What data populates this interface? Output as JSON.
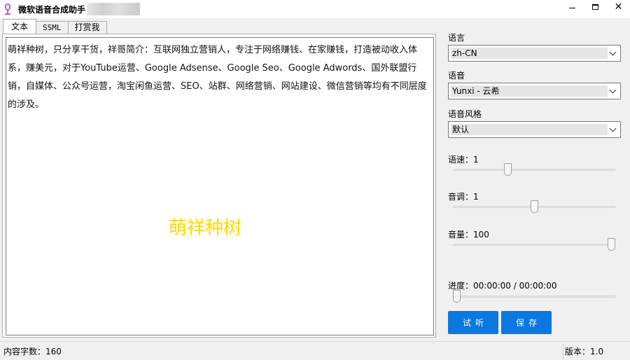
{
  "window": {
    "title": "微软语音合成助手",
    "controls": {
      "minimize": "minimize-icon",
      "maximize": "maximize-icon",
      "close": "✕"
    }
  },
  "tabs": [
    {
      "label": "文本",
      "active": true
    },
    {
      "label": "SSML",
      "active": false
    },
    {
      "label": "打赏我",
      "active": false
    }
  ],
  "editor": {
    "content": "萌祥种树，只分享干货，祥哥简介：互联网独立营销人，专注于网络赚钱、在家赚钱，打造被动收入体系，赚美元，对于YouTube运营、Google Adsense、Google Seo、Google Adwords、国外联盟行销，自媒体、公众号运营，淘宝闲鱼运营、SEO、站群、网络营销、网站建设、微信营销等均有不同层度的涉及。",
    "watermark": "萌祥种树"
  },
  "settings": {
    "language_label": "语言",
    "language_value": "zh-CN",
    "voice_label": "语音",
    "voice_value": "Yunxi - 云希",
    "style_label": "语音风格",
    "style_value": "默认",
    "rate_label": "语速：1",
    "rate_fraction": 0.33,
    "pitch_label": "音调：1",
    "pitch_fraction": 0.5,
    "volume_label": "音量：100",
    "volume_fraction": 1.0,
    "progress_label": "进度：00:00:00 / 00:00:00",
    "progress_fraction": 0.0
  },
  "buttons": {
    "preview": "试听",
    "save": "保存"
  },
  "status": {
    "char_count": "内容字数：160",
    "version": "版本：1.0"
  },
  "colors": {
    "accent": "#0a78e0",
    "watermark": "#ffd800",
    "icon": "#c257d8"
  }
}
